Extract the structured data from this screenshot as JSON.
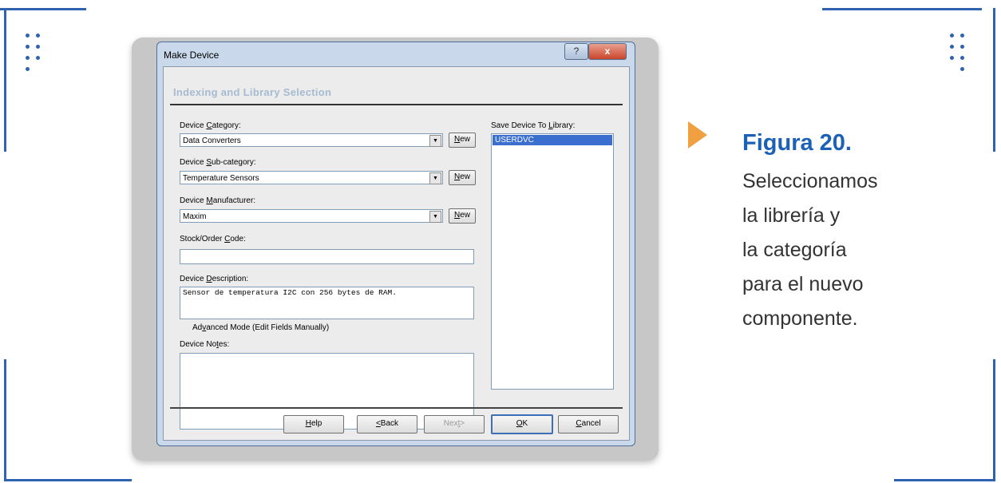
{
  "window": {
    "title": "Make Device",
    "help_glyph": "?",
    "close_glyph": "x",
    "section_heading": "Indexing and Library Selection"
  },
  "form": {
    "category": {
      "label_pre": "Device ",
      "label_key": "C",
      "label_post": "ategory:",
      "value": "Data Converters"
    },
    "subcategory": {
      "label_pre": "Device ",
      "label_key": "S",
      "label_post": "ub-category:",
      "value": "Temperature Sensors"
    },
    "manufacturer": {
      "label_pre": "Device ",
      "label_key": "M",
      "label_post": "anufacturer:",
      "value": "Maxim"
    },
    "new_button": {
      "key": "N",
      "rest": "ew"
    },
    "stock_code": {
      "label_pre": "Stock/Order ",
      "label_key": "C",
      "label_post": "ode:",
      "value": ""
    },
    "description": {
      "label_pre": "Device ",
      "label_key": "D",
      "label_post": "escription:",
      "value": "Sensor de temperatura I2C con 256 bytes de RAM."
    },
    "advanced": {
      "label_pre": "Ad",
      "label_key": "v",
      "label_post": "anced Mode (Edit Fields Manually)",
      "checked": false
    },
    "notes": {
      "label_pre": "Device No",
      "label_key": "t",
      "label_post": "es:",
      "value": ""
    }
  },
  "library": {
    "label_pre": "Save Device To ",
    "label_key": "L",
    "label_post": "ibrary:",
    "items": [
      "USERDVC"
    ]
  },
  "buttons": {
    "help": {
      "key": "H",
      "rest": "elp"
    },
    "back": {
      "key": "<",
      "rest": "Back"
    },
    "next": {
      "pre": "Nex",
      "key": "t",
      "rest": ">"
    },
    "ok": {
      "key": "O",
      "rest": "K"
    },
    "cancel": {
      "key": "C",
      "rest": "ancel"
    }
  },
  "caption": {
    "title": "Figura 20.",
    "lines": [
      "Seleccionamos",
      "la librería y",
      "la categoría",
      "para el nuevo",
      "componente."
    ]
  },
  "colors": {
    "frame": "#2f62b0",
    "arrow": "#f0a040",
    "caption_title": "#1c61b6"
  }
}
